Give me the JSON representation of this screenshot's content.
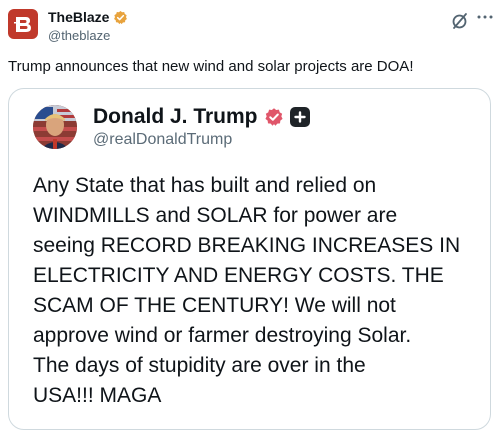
{
  "author": {
    "name": "TheBlaze",
    "handle": "@theblaze"
  },
  "tweet": {
    "text": "Trump announces that new wind and solar projects are DOA!"
  },
  "embed": {
    "name": "Donald J. Trump",
    "handle": "@realDonaldTrump",
    "lines": [
      "Any State that has built and relied on",
      "WINDMILLS and SOLAR for power are",
      "seeing RECORD BREAKING INCREASES IN",
      "ELECTRICITY AND ENERGY COSTS. THE",
      "SCAM OF THE CENTURY! We will not",
      "approve wind or farmer destroying Solar.",
      "The days of stupidity are over in the",
      "USA!!! MAGA"
    ]
  },
  "icons": {
    "avatar": "theblaze-logo-icon",
    "verified": "gold-verified-badge-icon",
    "grok": "grok-icon",
    "more": "more-options-icon",
    "truth_verified": "truth-verified-badge-icon",
    "plus": "plus-badge-icon"
  },
  "colors": {
    "brand_red": "#c0392b",
    "gold_badge": "#e8a33d",
    "truth_badge": "#e0566a",
    "secondary_text": "#536471",
    "card_border": "#cfd9de"
  }
}
